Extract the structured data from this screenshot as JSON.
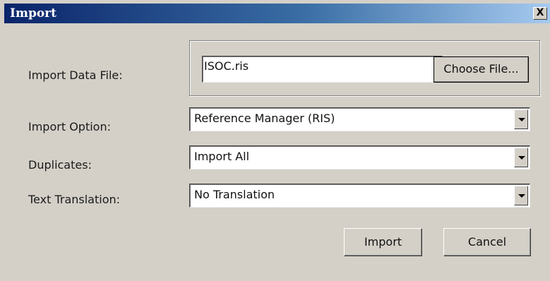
{
  "window": {
    "title": "Import",
    "close_glyph": "X"
  },
  "form": {
    "import_data_file": {
      "label": "Import Data File:",
      "value": "ISOC.ris",
      "choose_button": "Choose File..."
    },
    "import_option": {
      "label": "Import Option:",
      "selected": "Reference Manager (RIS)"
    },
    "duplicates": {
      "label": "Duplicates:",
      "selected": "Import All"
    },
    "text_translation": {
      "label": "Text Translation:",
      "selected": "No Translation"
    }
  },
  "actions": {
    "import_label": "Import",
    "cancel_label": "Cancel"
  },
  "colors": {
    "dialog_bg": "#d4d0c8",
    "titlebar_start": "#0a246a",
    "titlebar_end": "#a6caf0"
  },
  "icons": {
    "close": "close-icon",
    "dropdown": "chevron-down-icon"
  }
}
